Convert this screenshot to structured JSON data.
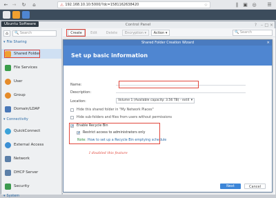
{
  "browser": {
    "url": "192.168.10.10:5000/?dc=1581162638420",
    "lock_icon": "lock-icon",
    "star_icon": "star-icon"
  },
  "tooltip": "Ubuntu Software",
  "window": {
    "title": "Control Panel"
  },
  "sidebar": {
    "search_placeholder": "Search",
    "section_file_sharing": "File Sharing",
    "section_connectivity": "Connectivity",
    "section_system": "System",
    "items": [
      {
        "label": "Shared Folder",
        "icon": "folder-share-icon",
        "color": "#f0a030"
      },
      {
        "label": "File Services",
        "icon": "file-services-icon",
        "color": "#3a9d4a"
      },
      {
        "label": "User",
        "icon": "user-icon",
        "color": "#e58b2a"
      },
      {
        "label": "Group",
        "icon": "group-icon",
        "color": "#e58b2a"
      },
      {
        "label": "Domain/LDAP",
        "icon": "domain-icon",
        "color": "#4a78b8"
      },
      {
        "label": "QuickConnect",
        "icon": "quickconnect-icon",
        "color": "#3ba2d9"
      },
      {
        "label": "External Access",
        "icon": "globe-icon",
        "color": "#3c8fd4"
      },
      {
        "label": "Network",
        "icon": "network-icon",
        "color": "#5b7fa8"
      },
      {
        "label": "DHCP Server",
        "icon": "dhcp-icon",
        "color": "#5b7fa8"
      },
      {
        "label": "Security",
        "icon": "shield-icon",
        "color": "#3c9a4f"
      }
    ]
  },
  "toolbar": {
    "create": "Create",
    "edit": "Edit",
    "delete": "Delete",
    "encryption": "Encryption",
    "action": "Action",
    "search_placeholder": "Search"
  },
  "wizard": {
    "title": "Shared Folder Creation Wizard",
    "header": "Set up basic information",
    "name_label": "Name:",
    "name_value": "",
    "description_label": "Description:",
    "location_label": "Location:",
    "location_value": "Volume 1 (Available capacity: 3.56 TB) - ext4",
    "hide_network_places": "Hide this shared folder in \"My Network Places\"",
    "hide_subfolders": "Hide sub-folders and files from users without permissions",
    "enable_recycle_bin": "Enable Recycle Bin",
    "restrict_admins": "Restrict access to administrators only",
    "note_label": "Note:",
    "note_link": "How to set up a Recycle Bin emptying schedule",
    "next": "Next",
    "cancel": "Cancel"
  },
  "annotation": "I disabled this feature",
  "colors": {
    "accent": "#4f86d1",
    "highlight_box": "#e0453a"
  }
}
